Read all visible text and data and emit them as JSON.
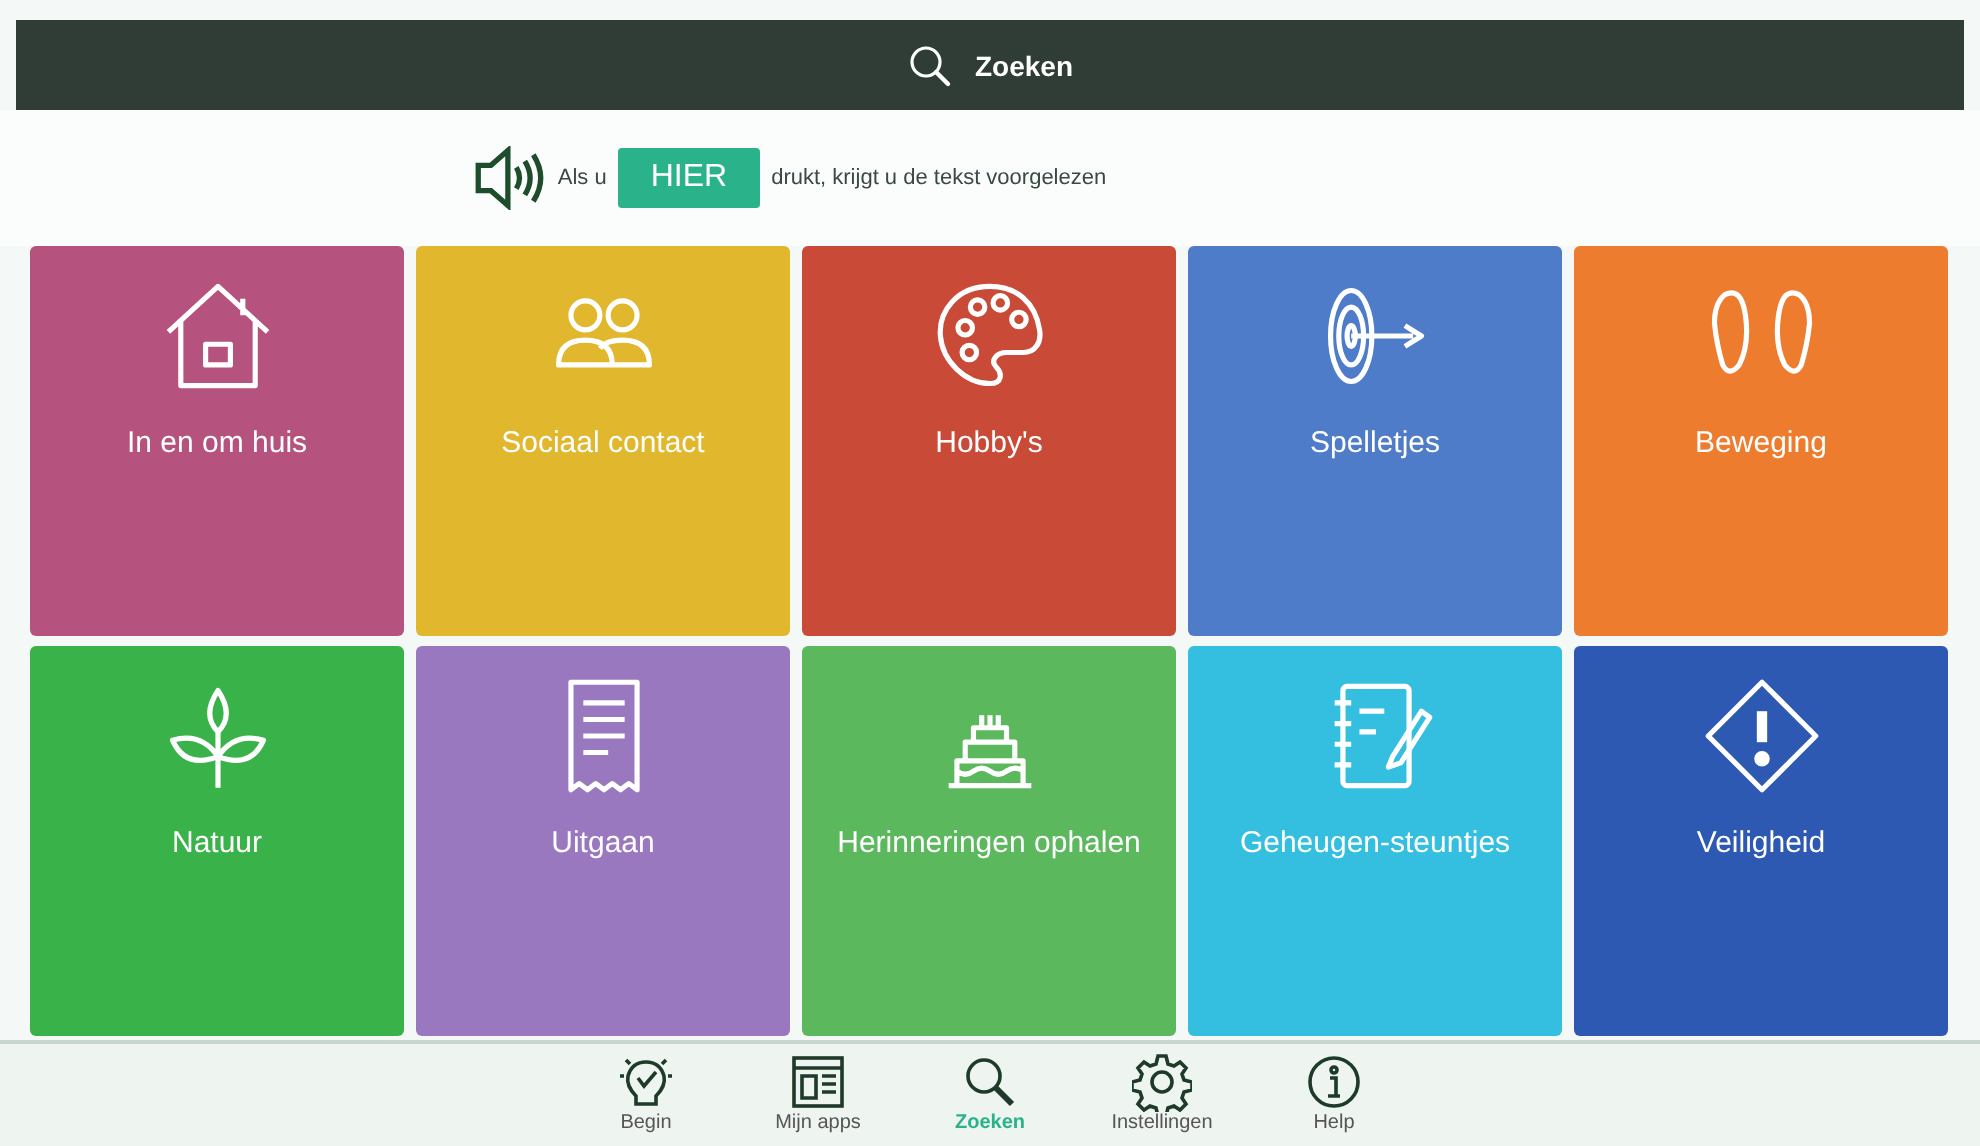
{
  "header": {
    "title": "Zoeken"
  },
  "read_aloud": {
    "before": "Als u",
    "button": "HIER",
    "after": "drukt, krijgt u de tekst voorgelezen"
  },
  "tiles": [
    {
      "label": "In en om huis",
      "kind": "house",
      "color": "#b5527e"
    },
    {
      "label": "Sociaal contact",
      "kind": "people",
      "color": "#e1b72d"
    },
    {
      "label": "Hobby's",
      "kind": "palette",
      "color": "#c94a36"
    },
    {
      "label": "Spelletjes",
      "kind": "dart",
      "color": "#4f7cc8"
    },
    {
      "label": "Beweging",
      "kind": "feet",
      "color": "#ee7c2f"
    },
    {
      "label": "Natuur",
      "kind": "plant",
      "color": "#3ab24a"
    },
    {
      "label": "Uitgaan",
      "kind": "receipt",
      "color": "#9a78c0"
    },
    {
      "label": "Herinneringen ophalen",
      "kind": "cake",
      "color": "#5cb85c"
    },
    {
      "label": "Geheugen-steuntjes",
      "kind": "notebook",
      "color": "#34bfe0"
    },
    {
      "label": "Veiligheid",
      "kind": "warning",
      "color": "#2e59b3"
    }
  ],
  "nav": [
    {
      "label": "Begin",
      "kind": "bulb",
      "selected": false
    },
    {
      "label": "Mijn apps",
      "kind": "apps",
      "selected": false
    },
    {
      "label": "Zoeken",
      "kind": "search",
      "selected": true
    },
    {
      "label": "Instellingen",
      "kind": "gear",
      "selected": false
    },
    {
      "label": "Help",
      "kind": "info",
      "selected": false
    }
  ]
}
